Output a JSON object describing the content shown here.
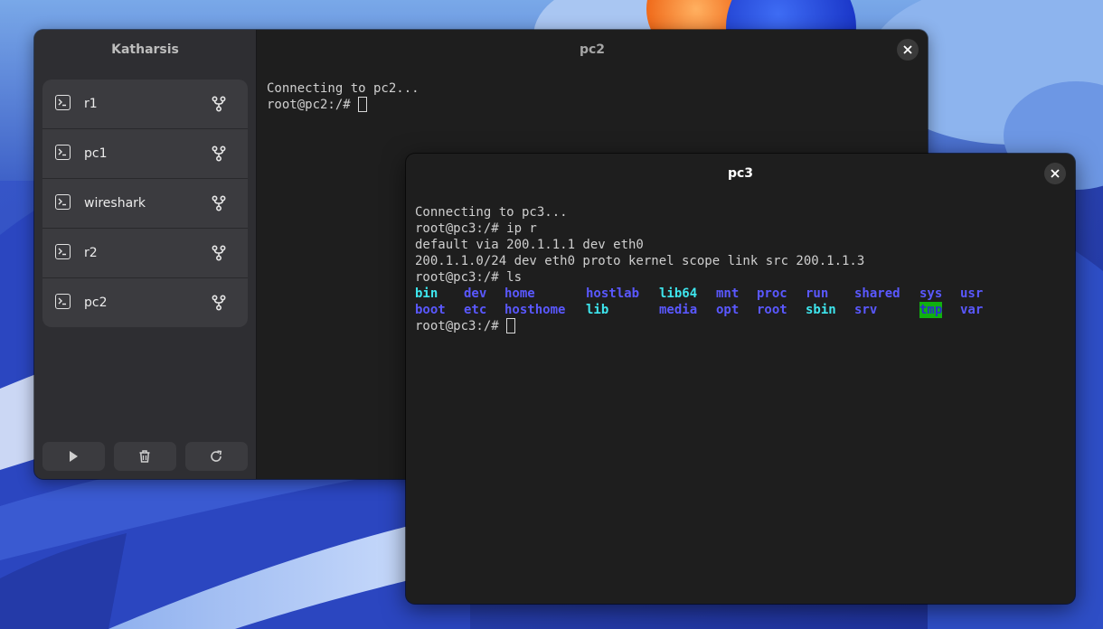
{
  "colors": {
    "directory": "#5a58ff",
    "symlink": "#3ee6ee",
    "sticky_dir_fg": "#2c2ccf",
    "sticky_dir_bg": "#10b010",
    "window_bg": "#1e1e1e",
    "sidebar_bg": "#2e2e32"
  },
  "app": {
    "title": "Katharsis",
    "devices": [
      {
        "name": "r1",
        "icon": "terminal-icon",
        "action_icon": "network-connect-icon"
      },
      {
        "name": "pc1",
        "icon": "terminal-icon",
        "action_icon": "network-connect-icon"
      },
      {
        "name": "wireshark",
        "icon": "terminal-icon",
        "action_icon": "network-connect-icon"
      },
      {
        "name": "r2",
        "icon": "terminal-icon",
        "action_icon": "network-connect-icon"
      },
      {
        "name": "pc2",
        "icon": "terminal-icon",
        "action_icon": "network-connect-icon"
      }
    ],
    "toolbar": {
      "start_icon": "play-icon",
      "delete_icon": "trash-icon",
      "restart_icon": "refresh-icon"
    }
  },
  "pc2_terminal": {
    "title": "pc2",
    "lines": [
      "Connecting to pc2...",
      "root@pc2:/# "
    ]
  },
  "pc3_terminal": {
    "title": "pc3",
    "lines": [
      "Connecting to pc3...",
      "root@pc3:/# ip r",
      "default via 200.1.1.1 dev eth0",
      "200.1.1.0/24 dev eth0 proto kernel scope link src 200.1.1.3",
      "root@pc3:/# ls"
    ],
    "ls_row1": [
      "bin",
      "dev",
      "home",
      "hostlab",
      "lib64",
      "mnt",
      "proc",
      "run",
      "shared",
      "sys",
      "usr"
    ],
    "ls_row2": [
      "boot",
      "etc",
      "hosthome",
      "lib",
      "media",
      "opt",
      "root",
      "sbin",
      "srv",
      "tmp",
      "var"
    ],
    "ls_row1_types": [
      "link",
      "dir",
      "dir",
      "dir",
      "link",
      "dir",
      "dir",
      "dir",
      "dir",
      "dir",
      "dir"
    ],
    "ls_row2_types": [
      "dir",
      "dir",
      "dir",
      "link",
      "dir",
      "dir",
      "dir",
      "link",
      "dir",
      "tmp",
      "dir"
    ],
    "prompt": "root@pc3:/# "
  }
}
